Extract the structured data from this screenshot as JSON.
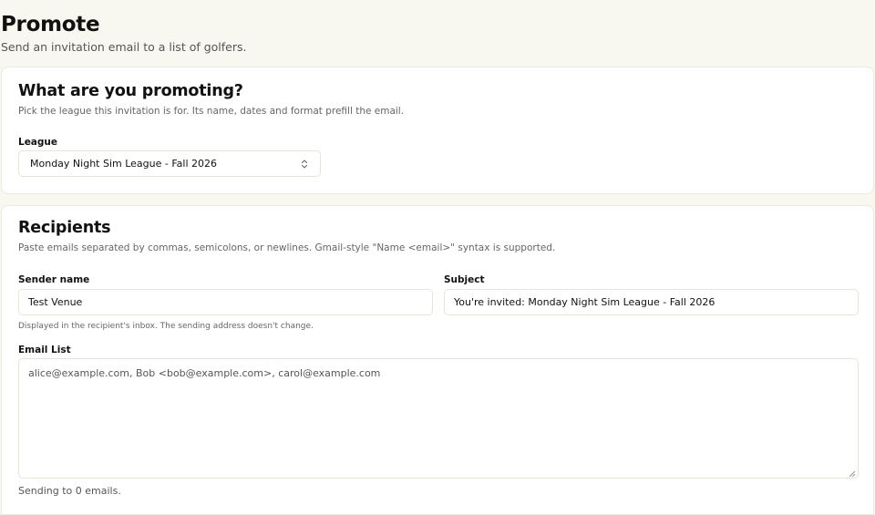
{
  "page": {
    "title": "Promote",
    "subtitle": "Send an invitation email to a list of golfers."
  },
  "league_card": {
    "title": "What are you promoting?",
    "description": "Pick the league this invitation is for. Its name, dates and format prefill the email.",
    "league_label": "League",
    "league_selected": "Monday Night Sim League - Fall 2026",
    "select_icon": "chevron-up-down-icon"
  },
  "recipients_card": {
    "title": "Recipients",
    "description": "Paste emails separated by commas, semicolons, or newlines. Gmail-style \"Name <email>\" syntax is supported.",
    "sender_label": "Sender name",
    "sender_value": "Test Venue",
    "sender_helper": "Displayed in the recipient's inbox. The sending address doesn't change.",
    "subject_label": "Subject",
    "subject_value": "You're invited: Monday Night Sim League - Fall 2026",
    "email_list_label": "Email List",
    "email_list_placeholder": "alice@example.com, Bob <bob@example.com>, carol@example.com",
    "count_text": "Sending to 0 emails."
  },
  "colors": {
    "background": "#f8f7f0",
    "card": "#ffffff",
    "border": "#e6e4dc"
  }
}
